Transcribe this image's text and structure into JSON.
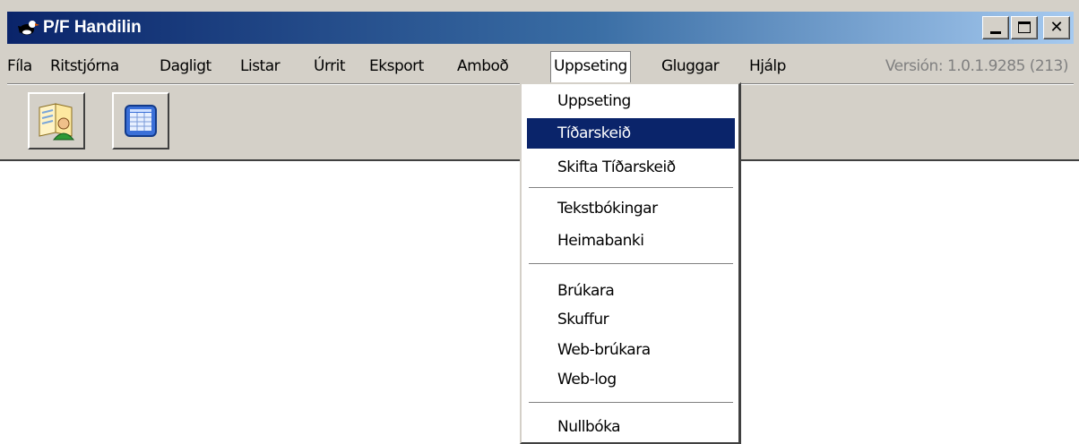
{
  "window": {
    "title": "P/F Handilin",
    "title_color": "#0a246a",
    "chrome_color": "#d4d0c8"
  },
  "window_controls": {
    "minimize": "minimize-icon",
    "maximize": "maximize-icon",
    "close_glyph": "✕"
  },
  "menubar": {
    "items": [
      "Fíla",
      "Ritstjórna",
      "Dagligt",
      "Listar",
      "Úrrit",
      "Eksport",
      "Amboð",
      "Uppseting",
      "Gluggar",
      "Hjálp"
    ],
    "open_item": "Uppseting",
    "version": "Versión: 1.0.1.9285 (213)"
  },
  "toolbar": {
    "buttons": [
      {
        "icon": "user-document-icon"
      },
      {
        "icon": "calendar-grid-icon"
      }
    ]
  },
  "dropdown": {
    "selected": "Tíðarskeið",
    "selection_color": "#0a246a",
    "groups": [
      [
        "Uppseting",
        "Tíðarskeið",
        "Skifta Tíðarskeið"
      ],
      [
        "Tekstbókingar",
        "Heimabanki"
      ],
      [
        "Brúkara",
        "Skuffur",
        "Web-brúkara",
        "Web-log"
      ],
      [
        "Nullbóka"
      ]
    ]
  }
}
